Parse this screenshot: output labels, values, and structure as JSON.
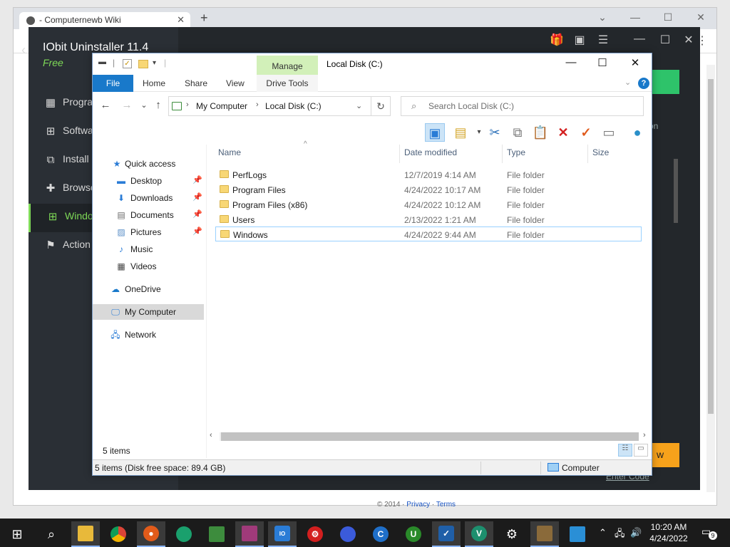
{
  "browser": {
    "tab_title": "- Computernewb Wiki",
    "footer_copy": "© 2014 ·",
    "footer_links": [
      "Privacy",
      "Terms"
    ]
  },
  "iobit": {
    "title": "IObit Uninstaller 11.4",
    "edition": "Free",
    "sidebar": [
      {
        "label": "Programs",
        "icon": "grid-icon"
      },
      {
        "label": "Software Updater",
        "icon": "update-icon"
      },
      {
        "label": "Install Monitor",
        "icon": "monitor-icon"
      },
      {
        "label": "Browser Extensions",
        "icon": "puzzle-icon"
      },
      {
        "label": "Windows Apps",
        "icon": "windows-icon"
      },
      {
        "label": "Action Center",
        "icon": "flag-icon"
      }
    ],
    "side_visible": [
      "Progra",
      "Softwa",
      "Install",
      "Browse",
      "Windo",
      "Action"
    ],
    "orange_btn_partial": "w",
    "enter_code": "Enter Code",
    "on_partial": "on",
    "accent_color": "#7ed957"
  },
  "explorer": {
    "title": "Local Disk (C:)",
    "manage": "Manage",
    "ribbon": {
      "file": "File",
      "tabs": [
        "Home",
        "Share",
        "View"
      ],
      "drive_tools": "Drive Tools"
    },
    "address": {
      "crumbs": [
        "My Computer",
        "Local Disk (C:)"
      ]
    },
    "search_placeholder": "Search Local Disk (C:)",
    "nav_pane": [
      {
        "label": "Quick access",
        "icon": "star-icon",
        "indent": 0,
        "pinned": false
      },
      {
        "label": "Desktop",
        "icon": "desktop-icon",
        "indent": 1,
        "pinned": true
      },
      {
        "label": "Downloads",
        "icon": "download-icon",
        "indent": 1,
        "pinned": true
      },
      {
        "label": "Documents",
        "icon": "document-icon",
        "indent": 1,
        "pinned": true
      },
      {
        "label": "Pictures",
        "icon": "pictures-icon",
        "indent": 1,
        "pinned": true
      },
      {
        "label": "Music",
        "icon": "music-icon",
        "indent": 1,
        "pinned": false
      },
      {
        "label": "Videos",
        "icon": "videos-icon",
        "indent": 1,
        "pinned": false
      },
      {
        "label": "OneDrive",
        "icon": "cloud-icon",
        "indent": 0,
        "pinned": false
      },
      {
        "label": "My Computer",
        "icon": "computer-icon",
        "indent": 0,
        "pinned": false
      },
      {
        "label": "Network",
        "icon": "network-icon",
        "indent": 0,
        "pinned": false
      }
    ],
    "columns": [
      "Name",
      "Date modified",
      "Type",
      "Size"
    ],
    "files": [
      {
        "name": "PerfLogs",
        "date": "12/7/2019 4:14 AM",
        "type": "File folder",
        "size": ""
      },
      {
        "name": "Program Files",
        "date": "4/24/2022 10:17 AM",
        "type": "File folder",
        "size": ""
      },
      {
        "name": "Program Files (x86)",
        "date": "4/24/2022 10:12 AM",
        "type": "File folder",
        "size": ""
      },
      {
        "name": "Users",
        "date": "2/13/2022 1:21 AM",
        "type": "File folder",
        "size": ""
      },
      {
        "name": "Windows",
        "date": "4/24/2022 9:44 AM",
        "type": "File folder",
        "size": ""
      }
    ],
    "item_count": "5 items",
    "status_text": "5 items (Disk free space: 89.4 GB)",
    "status_location": "Computer"
  },
  "taskbar": {
    "apps": [
      "file-explorer",
      "chrome",
      "browser",
      "edge",
      "monitor-app",
      "winrar",
      "iobit",
      "security",
      "malwarebytes",
      "ccleaner",
      "uninstaller",
      "vpn-shield",
      "vpn",
      "settings",
      "control-panel",
      "remote-desktop"
    ],
    "time": "10:20 AM",
    "date": "4/24/2022",
    "notifications": "9"
  }
}
